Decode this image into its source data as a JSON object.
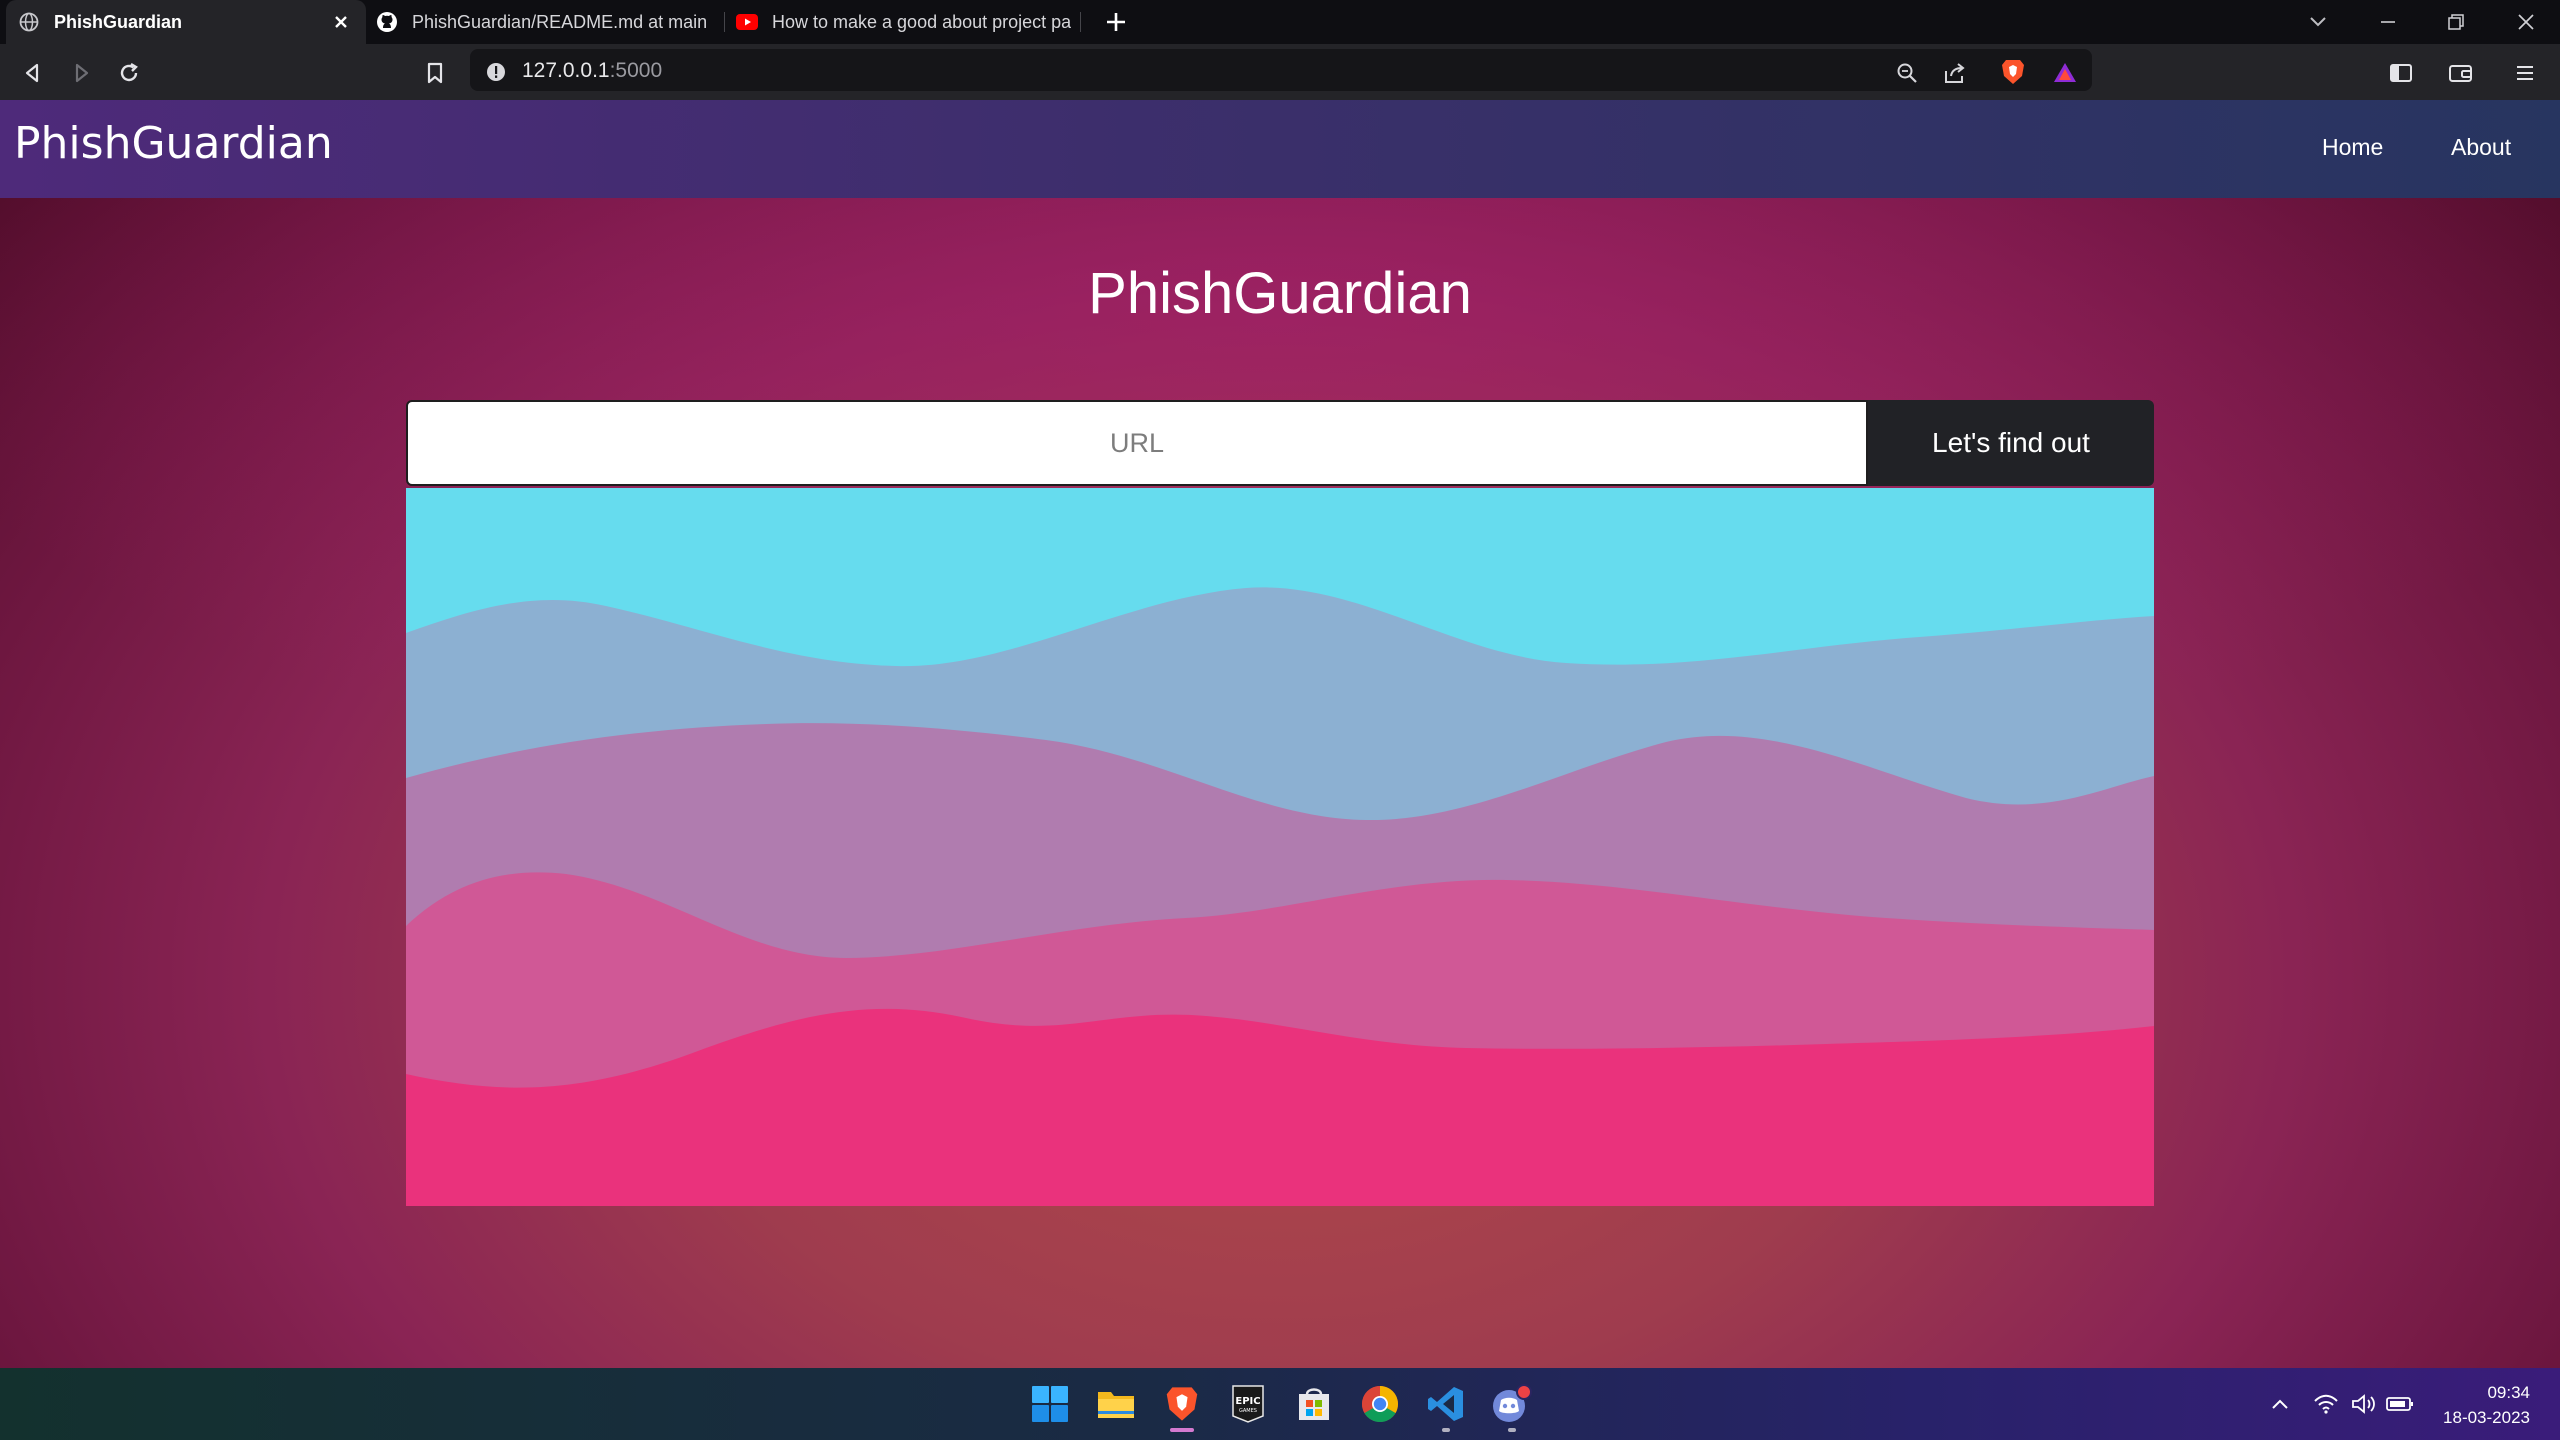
{
  "browser": {
    "tabs": [
      {
        "label": "PhishGuardian",
        "active": true,
        "icon": "globe-icon"
      },
      {
        "label": "PhishGuardian/README.md at main · ",
        "active": false,
        "icon": "github-icon"
      },
      {
        "label": "How to make a good about project pa",
        "active": false,
        "icon": "youtube-icon"
      }
    ],
    "address": {
      "host": "127.0.0.1",
      "port": ":5000"
    },
    "accent": "#242428"
  },
  "navbar": {
    "brand": "PhishGuardian",
    "links": [
      "Home",
      "About"
    ]
  },
  "main": {
    "title": "PhishGuardian",
    "search": {
      "placeholder": "URL",
      "value": "",
      "button_label": "Let's find out"
    },
    "wave_colors": [
      "#66dcee",
      "#8cb0d2",
      "#b07caf",
      "#d05896",
      "#ea327c"
    ]
  },
  "taskbar": {
    "apps": [
      "start-icon",
      "file-explorer-icon",
      "brave-icon",
      "epic-games-icon",
      "microsoft-store-icon",
      "chrome-icon",
      "vscode-icon",
      "discord-icon"
    ],
    "time": "09:34",
    "date": "18-03-2023"
  }
}
